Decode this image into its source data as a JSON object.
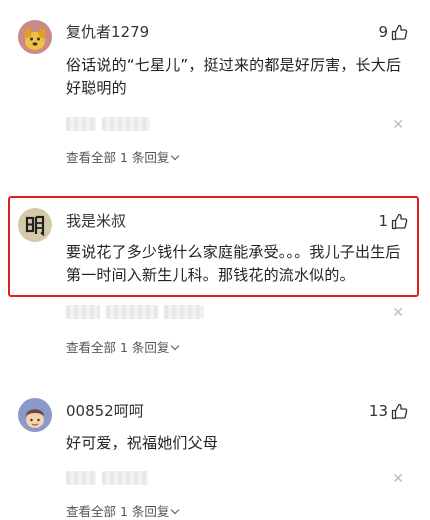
{
  "comments": [
    {
      "username": "复仇者1279",
      "likes": "9",
      "text": "俗话说的“七星儿”，挺过来的都是好厉害，长大后好聪明的",
      "replies_label": "查看全部 1 条回复",
      "avatar": "dog-icon",
      "highlighted": false
    },
    {
      "username": "我是米叔",
      "likes": "1",
      "text": "要说花了多少钱什么家庭能承受。。。我儿子出生后第一时间入新生儿科。那钱花的流水似的。",
      "replies_label": "查看全部 1 条回复",
      "avatar": "calligraphy-ming-icon",
      "highlighted": true
    },
    {
      "username": "00852呵呵",
      "likes": "13",
      "text": "好可爱，祝福她们父母",
      "replies_label": "查看全部 1 条回复",
      "avatar": "cartoon-character-icon",
      "highlighted": false
    }
  ],
  "colors": {
    "highlight_border": "#e02020",
    "text": "#222222",
    "muted": "#555555"
  }
}
